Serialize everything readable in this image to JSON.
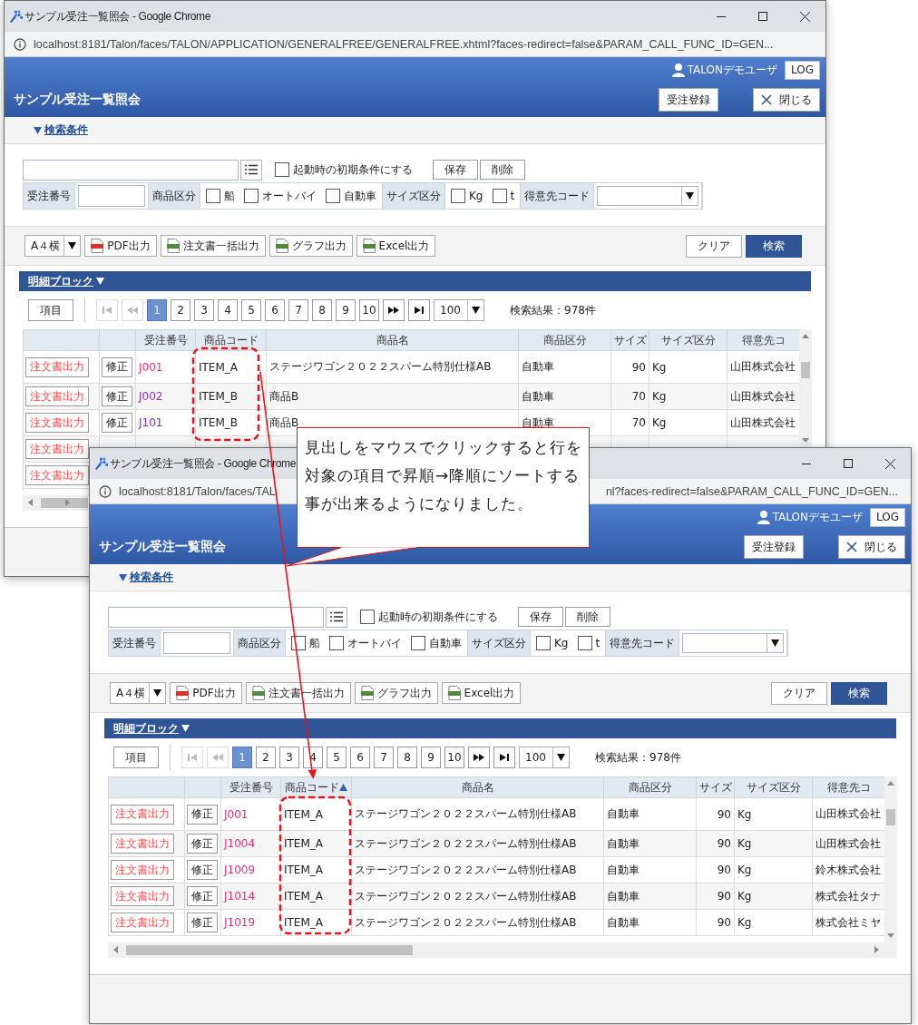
{
  "windows": [
    {
      "title": "サンプル受注一覧照会 - Google Chrome",
      "url_segments": [
        "localhost:8181/Talon/faces/TALON/APPLICATION/GENERALFREE/GENERALFREE.xhtml?faces-redirect=false&PARAM_CALL_FUNC_ID=GEN..."
      ],
      "user": "TALONデモユーザ",
      "logout": "LOG",
      "page_title": "サンプル受注一覧照会",
      "header_buttons": [
        {
          "kind": "register",
          "label": "受注登録"
        },
        {
          "kind": "close",
          "label": "閉じる"
        }
      ],
      "search_toggle": "検索条件",
      "search": {
        "default_checkbox": {
          "label": "起動時の初期条件にする",
          "checked": false
        },
        "buttons": [
          "保存",
          "削除"
        ],
        "fields": [
          {
            "kind": "text",
            "label": "受注番号"
          },
          {
            "kind": "checks",
            "label": "商品区分",
            "options": [
              {
                "label": "船",
                "checked": false
              },
              {
                "label": "オートバイ",
                "checked": false
              },
              {
                "label": "自動車",
                "checked": false
              }
            ]
          },
          {
            "kind": "checks",
            "label": "サイズ区分",
            "options": [
              {
                "label": "Kg",
                "checked": false
              },
              {
                "label": "t",
                "checked": false
              }
            ]
          },
          {
            "kind": "select",
            "label": "得意先コード"
          }
        ]
      },
      "toolbar": {
        "paper": "A４横",
        "exports": [
          {
            "kind": "pdf",
            "label": "PDF出力"
          },
          {
            "kind": "doc",
            "label": "注文書一括出力"
          },
          {
            "kind": "doc",
            "label": "グラフ出力"
          },
          {
            "kind": "doc",
            "label": "Excel出力"
          }
        ],
        "clear": "クリア",
        "search": "検索"
      },
      "detail_toggle": "明細ブロック",
      "pager": {
        "columns_button": "項目",
        "nav_before": [
          {
            "kind": "first",
            "disabled": true
          },
          {
            "kind": "prev",
            "disabled": true
          }
        ],
        "pages": [
          {
            "label": "1",
            "selected": true
          },
          {
            "label": "2",
            "selected": false
          },
          {
            "label": "3",
            "selected": false
          },
          {
            "label": "4",
            "selected": false
          },
          {
            "label": "5",
            "selected": false
          },
          {
            "label": "6",
            "selected": false
          },
          {
            "label": "7",
            "selected": false
          },
          {
            "label": "8",
            "selected": false
          },
          {
            "label": "9",
            "selected": false
          },
          {
            "label": "10",
            "selected": false
          }
        ],
        "nav_after": [
          {
            "kind": "next",
            "disabled": false
          },
          {
            "kind": "last",
            "disabled": false
          }
        ],
        "page_size": "100",
        "result": "検索結果：978件"
      },
      "table": {
        "columns": [
          {
            "sorted": false
          },
          {
            "sorted": false
          },
          {
            "label": "受注番号",
            "sorted": false
          },
          {
            "label": "商品コード",
            "sorted": false
          },
          {
            "label": "商品名",
            "sorted": false
          },
          {
            "label": "商品区分",
            "sorted": false
          },
          {
            "label": "サイズ",
            "sorted": false
          },
          {
            "label": "サイズ区分",
            "sorted": false
          },
          {
            "label": "得意先コ",
            "sorted": false
          }
        ],
        "rows": [
          {
            "order_button": "注文書出力",
            "edit_button": "修正",
            "order_no": "J001",
            "visited": false,
            "code": "ITEM_A",
            "name": "ステージワゴン２０２２スパーム特別仕様AB",
            "category": "自動車",
            "size": "90",
            "size_unit": "Kg",
            "customer": "山田株式会社"
          },
          {
            "order_button": "注文書出力",
            "edit_button": "修正",
            "order_no": "J002",
            "visited": true,
            "code": "ITEM_B",
            "name": "商品B",
            "category": "自動車",
            "size": "70",
            "size_unit": "Kg",
            "customer": "山田株式会社"
          },
          {
            "order_button": "注文書出力",
            "edit_button": "修正",
            "order_no": "J101",
            "visited": true,
            "code": "ITEM_B",
            "name": "商品B",
            "category": "自動車",
            "size": "70",
            "size_unit": "Kg",
            "customer": "山田株式会社"
          },
          {
            "order_button": "注文書出力"
          },
          {
            "order_button": "注文書出力"
          }
        ]
      }
    },
    {
      "title": "サンプル受注一覧照会 - Google Chrome",
      "url_segments": [
        "localhost:8181/Talon/faces/TAL",
        "nl?faces-redirect=false&PARAM_CALL_FUNC_ID=GEN..."
      ],
      "user": "TALONデモユーザ",
      "logout": "LOG",
      "page_title": "サンプル受注一覧照会",
      "header_buttons": [
        {
          "kind": "register",
          "label": "受注登録"
        },
        {
          "kind": "close",
          "label": "閉じる"
        }
      ],
      "search_toggle": "検索条件",
      "search": {
        "default_checkbox": {
          "label": "起動時の初期条件にする",
          "checked": false
        },
        "buttons": [
          "保存",
          "削除"
        ],
        "fields": [
          {
            "kind": "text",
            "label": "受注番号"
          },
          {
            "kind": "checks",
            "label": "商品区分",
            "options": [
              {
                "label": "船",
                "checked": false
              },
              {
                "label": "オートバイ",
                "checked": false
              },
              {
                "label": "自動車",
                "checked": false
              }
            ]
          },
          {
            "kind": "checks",
            "label": "サイズ区分",
            "options": [
              {
                "label": "Kg",
                "checked": false
              },
              {
                "label": "t",
                "checked": false
              }
            ]
          },
          {
            "kind": "select",
            "label": "得意先コード"
          }
        ]
      },
      "toolbar": {
        "paper": "A４横",
        "exports": [
          {
            "kind": "pdf",
            "label": "PDF出力"
          },
          {
            "kind": "doc",
            "label": "注文書一括出力"
          },
          {
            "kind": "doc",
            "label": "グラフ出力"
          },
          {
            "kind": "doc",
            "label": "Excel出力"
          }
        ],
        "clear": "クリア",
        "search": "検索"
      },
      "detail_toggle": "明細ブロック",
      "pager": {
        "columns_button": "項目",
        "nav_before": [
          {
            "kind": "first",
            "disabled": true
          },
          {
            "kind": "prev",
            "disabled": true
          }
        ],
        "pages": [
          {
            "label": "1",
            "selected": true
          },
          {
            "label": "2",
            "selected": false
          },
          {
            "label": "3",
            "selected": false
          },
          {
            "label": "4",
            "selected": false
          },
          {
            "label": "5",
            "selected": false
          },
          {
            "label": "6",
            "selected": false
          },
          {
            "label": "7",
            "selected": false
          },
          {
            "label": "8",
            "selected": false
          },
          {
            "label": "9",
            "selected": false
          },
          {
            "label": "10",
            "selected": false
          }
        ],
        "nav_after": [
          {
            "kind": "next",
            "disabled": false
          },
          {
            "kind": "last",
            "disabled": false
          }
        ],
        "page_size": "100",
        "result": "検索結果：978件"
      },
      "table": {
        "columns": [
          {
            "sorted": false
          },
          {
            "sorted": false
          },
          {
            "label": "受注番号",
            "sorted": false
          },
          {
            "label": "商品コード",
            "sorted": true
          },
          {
            "label": "商品名",
            "sorted": false
          },
          {
            "label": "商品区分",
            "sorted": false
          },
          {
            "label": "サイズ",
            "sorted": false
          },
          {
            "label": "サイズ区分",
            "sorted": false
          },
          {
            "label": "得意先コ",
            "sorted": false
          }
        ],
        "rows": [
          {
            "order_button": "注文書出力",
            "edit_button": "修正",
            "order_no": "J001",
            "visited": false,
            "code": "ITEM_A",
            "name": "ステージワゴン２０２２スパーム特別仕様AB",
            "category": "自動車",
            "size": "90",
            "size_unit": "Kg",
            "customer": "山田株式会社"
          },
          {
            "order_button": "注文書出力",
            "edit_button": "修正",
            "order_no": "J1004",
            "visited": false,
            "code": "ITEM_A",
            "name": "ステージワゴン２０２２スパーム特別仕様AB",
            "category": "自動車",
            "size": "90",
            "size_unit": "Kg",
            "customer": "山田株式会社"
          },
          {
            "order_button": "注文書出力",
            "edit_button": "修正",
            "order_no": "J1009",
            "visited": false,
            "code": "ITEM_A",
            "name": "ステージワゴン２０２２スパーム特別仕様AB",
            "category": "自動車",
            "size": "90",
            "size_unit": "Kg",
            "customer": "鈴木株式会社"
          },
          {
            "order_button": "注文書出力",
            "edit_button": "修正",
            "order_no": "J1014",
            "visited": false,
            "code": "ITEM_A",
            "name": "ステージワゴン２０２２スパーム特別仕様AB",
            "category": "自動車",
            "size": "90",
            "size_unit": "Kg",
            "customer": "株式会社タナ"
          },
          {
            "order_button": "注文書出力",
            "edit_button": "修正",
            "order_no": "J1019",
            "visited": false,
            "code": "ITEM_A",
            "name": "ステージワゴン２０２２スパーム特別仕様AB",
            "category": "自動車",
            "size": "90",
            "size_unit": "Kg",
            "customer": "株式会社ミヤ"
          }
        ]
      }
    }
  ],
  "callout": {
    "text": "見出しをマウスでクリックすると行を対象の項目で昇順→降順にソートする事が出来るようになりました。"
  }
}
